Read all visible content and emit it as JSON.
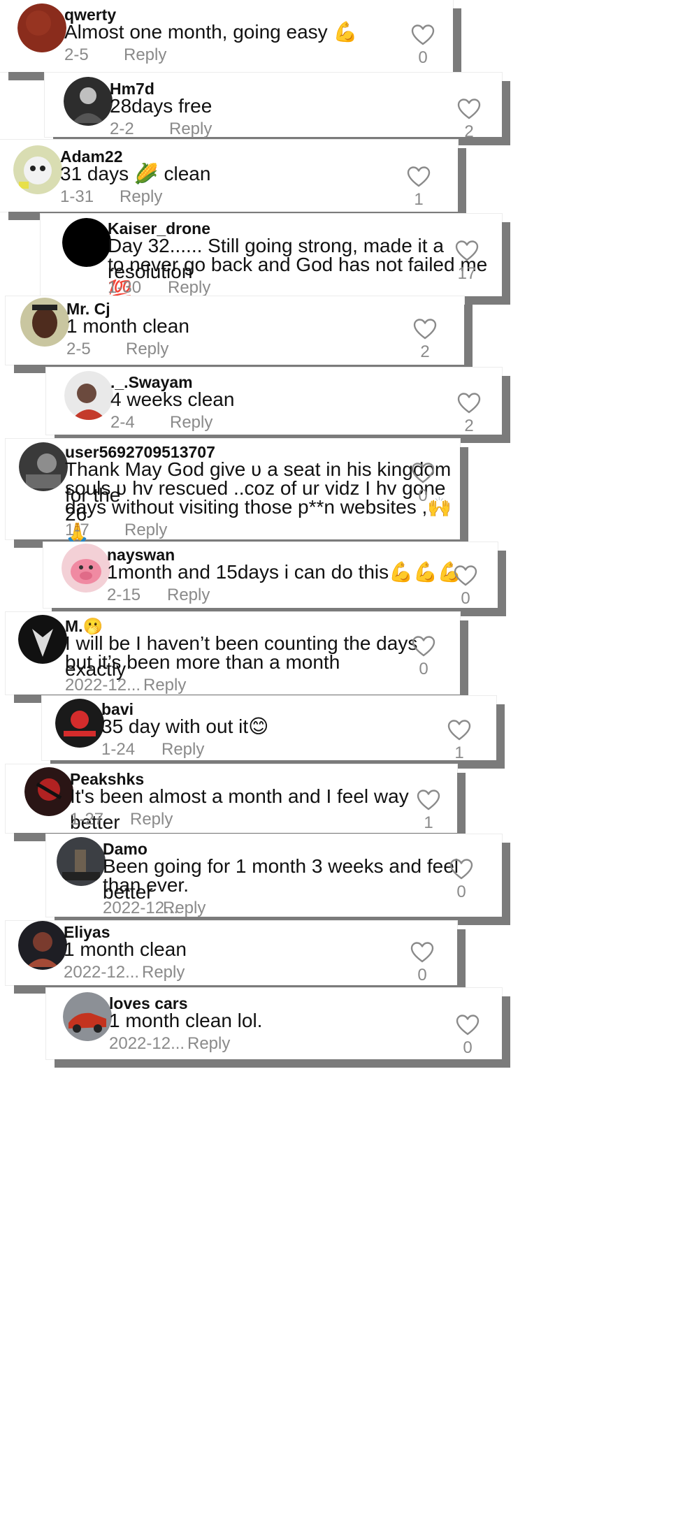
{
  "comments": [
    {
      "user": "qwerty",
      "text": "Almost one month, going easy 💪",
      "date": "2-5",
      "reply": "Reply",
      "likes": "0"
    },
    {
      "user": "Hm7d",
      "text": "28days free",
      "date": "2-2",
      "reply": "Reply",
      "likes": "2"
    },
    {
      "user": "Adam22",
      "text": "31 days 🌽 clean",
      "date": "1-31",
      "reply": "Reply",
      "likes": "1"
    },
    {
      "user": "Kaiser_drone",
      "text_line1": "Day 32...... Still going strong, made it a resolution",
      "text_line2": "to never go back and God has not failed me 💯",
      "date": "1-30",
      "reply": "Reply",
      "likes": "17"
    },
    {
      "user": "Mr. Cj",
      "text": "1 month clean",
      "date": "2-5",
      "reply": "Reply",
      "likes": "2"
    },
    {
      "user": "._.Swayam",
      "text": "4 weeks clean",
      "date": "2-4",
      "reply": "Reply",
      "likes": "2"
    },
    {
      "user": "user5692709513707",
      "text_line1": "Thank May God give ʋ a seat in his kingdom for the",
      "text_line2": "souls ʋ hv rescued ..coz of ur vidz I hv gone 26",
      "text_line3": "days without visiting those p**n websites ,🙌🙏",
      "date": "1-7",
      "reply": "Reply",
      "likes": "0"
    },
    {
      "user": "nayswan",
      "text": "1month and 15days i can do this💪💪💪",
      "date": "2-15",
      "reply": "Reply",
      "likes": "0"
    },
    {
      "user": "M.🫢",
      "text_line1": "I will be I haven’t been counting the days exactly",
      "text_line2": "but it’s been more than a month",
      "date": "2022-12...",
      "reply": "Reply",
      "likes": "0"
    },
    {
      "user": "bavi",
      "text": "35 day with out it😊",
      "date": "1-24",
      "reply": "Reply",
      "likes": "1"
    },
    {
      "user": "Peakshks",
      "text": "It's been almost a month and I feel way better",
      "date": "1-27",
      "reply": "Reply",
      "likes": "1"
    },
    {
      "user": "Damo",
      "text_line1": "Been going for 1 month 3 weeks and feel better",
      "text_line2": "than ever.",
      "date": "2022-12...",
      "reply": "Reply",
      "likes": "0"
    },
    {
      "user": "Eliyas",
      "text": "1 month clean",
      "date": "2022-12...",
      "reply": "Reply",
      "likes": "0"
    },
    {
      "user": "loves cars",
      "text": "1 month clean lol.",
      "date": "2022-12...",
      "reply": "Reply",
      "likes": "0"
    }
  ]
}
